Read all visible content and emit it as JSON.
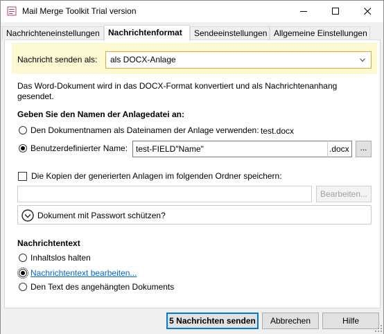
{
  "window": {
    "title": "Mail Merge Toolkit Trial version",
    "minimize": "—",
    "maximize": "☐",
    "close": "✕"
  },
  "tabs": [
    {
      "label": "Nachrichteneinstellungen"
    },
    {
      "label": "Nachrichtenformat"
    },
    {
      "label": "Sendeeinstellungen"
    },
    {
      "label": "Allgemeine Einstellungen"
    }
  ],
  "send_as": {
    "label": "Nachricht senden als:",
    "value": "als DOCX-Anlage",
    "chevron": "⌄"
  },
  "description": {
    "line1": "Das Word-Dokument wird in das DOCX-Format konvertiert und als Nachrichtenanhang",
    "line2": "gesendet."
  },
  "attachment_name": {
    "heading": "Geben Sie den Namen der Anlagedatei an:",
    "option_docname": "Den Dokumentnamen als Dateinamen der Anlage verwenden:",
    "docname_value": "test.docx",
    "option_custom": "Benutzerdefinierter Name:",
    "custom_value": "test-FIELD\"Name\"",
    "extension": ".docx",
    "browse": "..."
  },
  "copies": {
    "label": "Die Kopien der generierten Anlagen im folgenden Ordner speichern:",
    "folder_value": "",
    "edit_button": "Bearbeiten..."
  },
  "password": {
    "label": "Dokument mit Passwort schützen?",
    "icon": "⌄"
  },
  "message_text": {
    "heading": "Nachrichtentext",
    "option_empty": "Inhaltslos halten",
    "option_edit": "Nachrichtentext bearbeiten...",
    "option_attached": "Den Text des angehängten Dokuments"
  },
  "footer": {
    "send": "5 Nachrichten senden",
    "cancel": "Abbrechen",
    "help": "Hilfe"
  }
}
